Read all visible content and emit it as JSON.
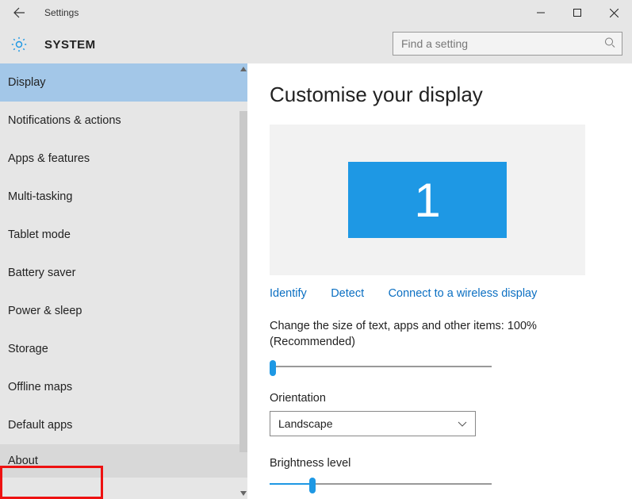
{
  "window": {
    "title": "Settings"
  },
  "header": {
    "title": "SYSTEM",
    "search_placeholder": "Find a setting"
  },
  "sidebar": {
    "items": [
      {
        "label": "Display",
        "selected": true
      },
      {
        "label": "Notifications & actions"
      },
      {
        "label": "Apps & features"
      },
      {
        "label": "Multi-tasking"
      },
      {
        "label": "Tablet mode"
      },
      {
        "label": "Battery saver"
      },
      {
        "label": "Power & sleep"
      },
      {
        "label": "Storage"
      },
      {
        "label": "Offline maps"
      },
      {
        "label": "Default apps"
      },
      {
        "label": "About",
        "highlighted": true
      }
    ]
  },
  "content": {
    "title": "Customise your display",
    "monitor_number": "1",
    "identify_link": "Identify",
    "detect_link": "Detect",
    "wireless_link": "Connect to a wireless display",
    "scale_text": "Change the size of text, apps and other items: 100% (Recommended)",
    "orientation_label": "Orientation",
    "orientation_value": "Landscape",
    "brightness_label": "Brightness level",
    "scale_slider_percent": 0,
    "brightness_slider_percent": 18
  },
  "colors": {
    "accent": "#1e98e4",
    "link": "#0b6fc2",
    "highlight_border": "#e11"
  }
}
